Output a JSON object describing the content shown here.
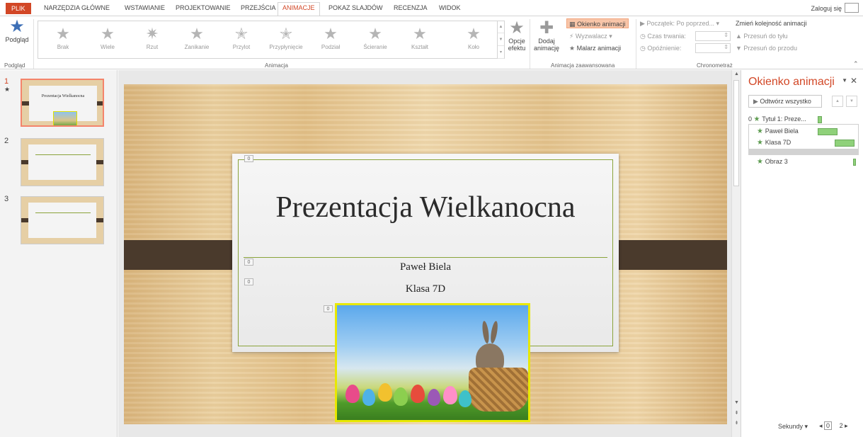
{
  "tabs": {
    "file": "PLIK",
    "items": [
      "NARZĘDZIA GŁÓWNE",
      "WSTAWIANIE",
      "PROJEKTOWANIE",
      "PRZEJŚCIA",
      "ANIMACJE",
      "POKAZ SLAJDÓW",
      "RECENZJA",
      "WIDOK"
    ],
    "active": "ANIMACJE",
    "login": "Zaloguj się"
  },
  "ribbon": {
    "preview": {
      "label": "Podgląd",
      "group": "Podgląd"
    },
    "animations": {
      "group": "Animacja",
      "items": [
        "Brak",
        "Wiele",
        "Rzut",
        "Zanikanie",
        "Przylot",
        "Przypłynięcie",
        "Podział",
        "Ścieranie",
        "Kształt",
        "Koło"
      ],
      "effect_options": [
        "Opcje",
        "efektu"
      ]
    },
    "advanced": {
      "group": "Animacja zaawansowana",
      "add_animation": [
        "Dodaj",
        "animację"
      ],
      "animation_pane": "Okienko animacji",
      "trigger": "Wyzwalacz",
      "painter": "Malarz animacji"
    },
    "timing": {
      "group": "Chronometraż",
      "start_label": "Początek:",
      "start_value": "Po poprzed...",
      "duration_label": "Czas trwania:",
      "delay_label": "Opóźnienie:",
      "reorder": "Zmień kolejność animacji",
      "move_earlier": "Przesuń do tyłu",
      "move_later": "Przesuń do przodu"
    }
  },
  "thumbnails": {
    "numbers": [
      "1",
      "2",
      "3"
    ],
    "slide1_title": "Prezentacja Wielkanocna"
  },
  "slide": {
    "title": "Prezentacja Wielkanocna",
    "subtitle1": "Paweł Biela",
    "subtitle2": "Klasa 7D",
    "tag": "0"
  },
  "animation_pane": {
    "title": "Okienko animacji",
    "play_all": "Odtwórz wszystko",
    "entries": [
      {
        "index": "0",
        "name": "Tytuł 1: Preze..."
      },
      {
        "index": "",
        "name": "Paweł Biela"
      },
      {
        "index": "",
        "name": "Klasa 7D"
      },
      {
        "index": "",
        "name": "Obraz 3"
      }
    ],
    "seconds": "Sekundy",
    "scale_start": "0",
    "scale_mid": "2"
  },
  "colors": {
    "accent": "#d24726",
    "frame_green": "#8aa33b",
    "highlight": "#e8e800",
    "anim_bar": "#8fd17a"
  }
}
